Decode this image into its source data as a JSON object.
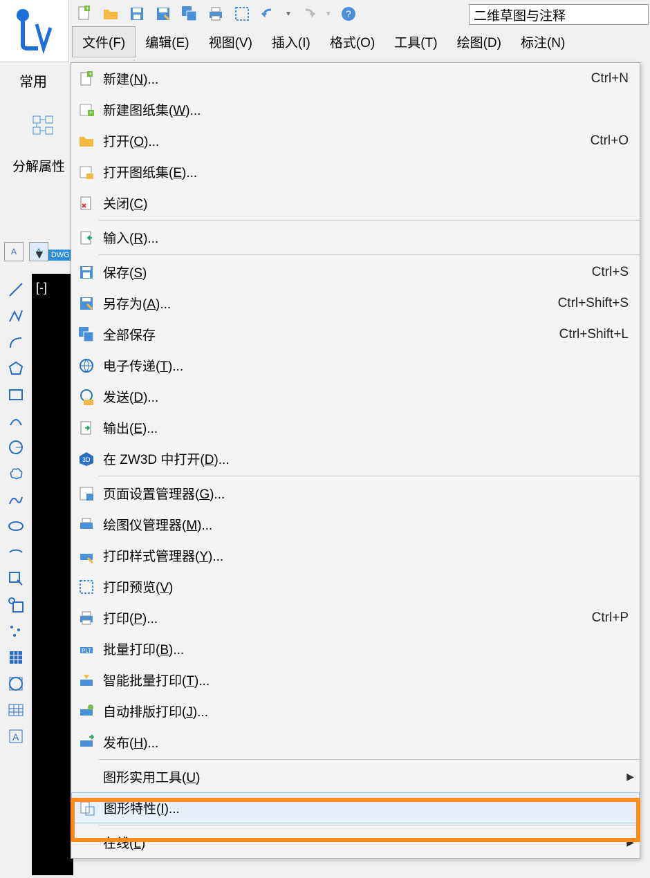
{
  "searchBox": "二维草图与注释",
  "menubar": [
    "文件(F)",
    "编辑(E)",
    "视图(V)",
    "插入(I)",
    "格式(O)",
    "工具(T)",
    "绘图(D)",
    "标注(N)"
  ],
  "ribbonTab": "常用",
  "ribbonGroupLabel": "分解属性",
  "fileMenu": {
    "items": [
      {
        "label": "新建(N)...",
        "shortcut": "Ctrl+N",
        "icon": "new-file"
      },
      {
        "label": "新建图纸集(W)...",
        "icon": "new-sheet"
      },
      {
        "label": "打开(O)...",
        "shortcut": "Ctrl+O",
        "icon": "open-folder"
      },
      {
        "label": "打开图纸集(E)...",
        "icon": "open-sheet"
      },
      {
        "label": "关闭(C)",
        "icon": "close-file"
      },
      {
        "sep": true
      },
      {
        "label": "输入(R)...",
        "icon": "import"
      },
      {
        "sep": true
      },
      {
        "label": "保存(S)",
        "shortcut": "Ctrl+S",
        "icon": "save"
      },
      {
        "label": "另存为(A)...",
        "shortcut": "Ctrl+Shift+S",
        "icon": "save-as"
      },
      {
        "label": "全部保存",
        "shortcut": "Ctrl+Shift+L",
        "icon": "save-all"
      },
      {
        "label": "电子传递(T)...",
        "icon": "etransmit"
      },
      {
        "label": "发送(D)...",
        "icon": "send"
      },
      {
        "label": "输出(E)...",
        "icon": "export"
      },
      {
        "label": "在 ZW3D 中打开(D)...",
        "icon": "zw3d"
      },
      {
        "sep": true
      },
      {
        "label": "页面设置管理器(G)...",
        "icon": "page-setup"
      },
      {
        "label": "绘图仪管理器(M)...",
        "icon": "plotter"
      },
      {
        "label": "打印样式管理器(Y)...",
        "icon": "plot-style"
      },
      {
        "label": "打印预览(V)",
        "icon": "print-preview"
      },
      {
        "label": "打印(P)...",
        "shortcut": "Ctrl+P",
        "icon": "print"
      },
      {
        "label": "批量打印(B)...",
        "icon": "batch-print"
      },
      {
        "label": "智能批量打印(T)...",
        "icon": "smart-batch-print"
      },
      {
        "label": "自动排版打印(J)...",
        "icon": "auto-print"
      },
      {
        "label": "发布(H)...",
        "icon": "publish"
      },
      {
        "sep": true
      },
      {
        "label": "图形实用工具(U)",
        "submenu": true
      },
      {
        "label": "图形特性(I)...",
        "highlighted": true,
        "icon": "drawing-props"
      },
      {
        "sep": true
      },
      {
        "label": "在线(L)",
        "submenu": true
      }
    ]
  },
  "docTabLabel": "[-]",
  "tabIcons": [
    "dwg-doc"
  ]
}
